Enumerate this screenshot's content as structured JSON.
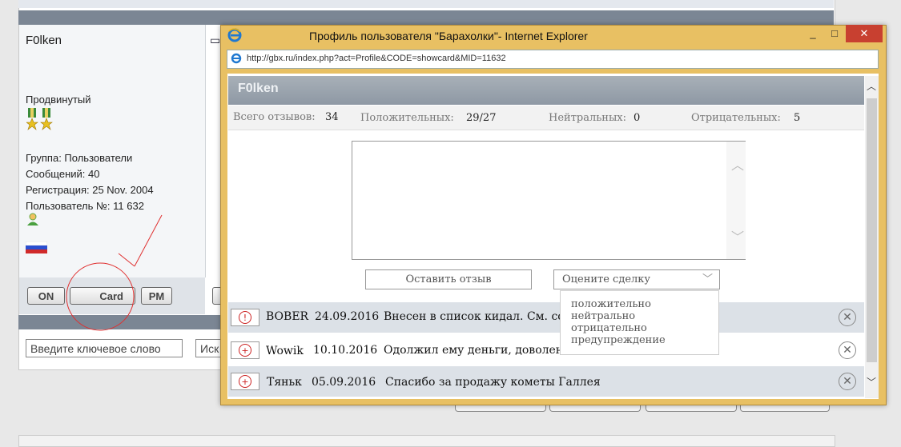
{
  "forum": {
    "user": {
      "name": "F0lken",
      "rank": "Продвинутый",
      "info": [
        "Группа: Пользователи",
        "Сообщений: 40",
        "Регистрация: 25 Nov. 2004",
        "Пользователь №: 11 632"
      ]
    },
    "buttons": {
      "on": "ON",
      "card": "Card",
      "pm": "PM"
    },
    "search_placeholder": "Введите ключевое слово",
    "search_button": "Иск"
  },
  "popup": {
    "title": "Профиль пользователя \"Барахолки\"- Internet Explorer",
    "url": "http://gbx.ru/index.php?act=Profile&CODE=showcard&MID=11632",
    "profile_name": "F0lken",
    "stats": {
      "total_label": "Всего отзывов:",
      "total": "34",
      "positive_label": "Положительных:",
      "positive": "29/27",
      "neutral_label": "Нейтральных:",
      "neutral": "0",
      "negative_label": "Отрицательных:",
      "negative": "5"
    },
    "leave_review": "Оставить отзыв",
    "rate_select": "Оцените сделку",
    "rate_options": [
      "положительно",
      "нейтрально",
      "отрицательно",
      "предупреждение"
    ],
    "reviews": [
      {
        "icon": "!",
        "user": "BOBER",
        "date": "24.09.2016",
        "text": "Внесен в список кидал. См. сс"
      },
      {
        "icon": "+",
        "user": "Wowik",
        "date": "10.10.2016",
        "text": "Одолжил ему деньги, доволен"
      },
      {
        "icon": "+",
        "user": "Тяньк",
        "date": "05.09.2016",
        "text": "Спасибо за продажу кометы Галлея"
      }
    ]
  },
  "colors": {
    "accent_red": "#cc2222",
    "header_gray": "#8e98a4",
    "window_frame": "#e8c063"
  }
}
